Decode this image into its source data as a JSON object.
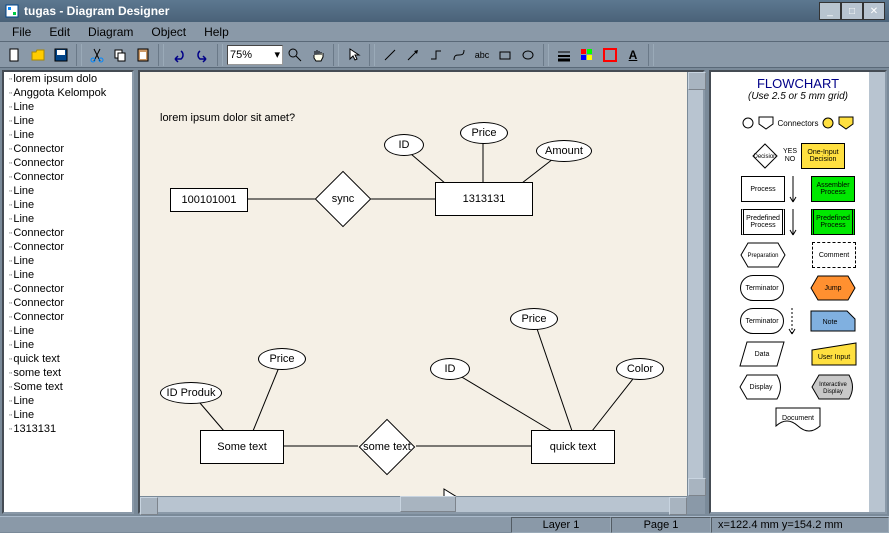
{
  "titlebar": {
    "title": "tugas - Diagram Designer"
  },
  "menu": {
    "file": "File",
    "edit": "Edit",
    "diagram": "Diagram",
    "object": "Object",
    "help": "Help"
  },
  "toolbar": {
    "zoom": "75%"
  },
  "tree": {
    "items": [
      "lorem ipsum dolo",
      "Anggota Kelompok",
      "Line",
      "Line",
      "Line",
      "Connector",
      "Connector",
      "Connector",
      "Line",
      "Line",
      "Line",
      "Connector",
      "Connector",
      "Line",
      "Line",
      "Connector",
      "Connector",
      "Connector",
      "Line",
      "Line",
      "quick text",
      "some text",
      "Some text",
      "Line",
      "Line",
      "1313131"
    ]
  },
  "canvas": {
    "question": "lorem ipsum dolor sit amet?",
    "rect1": "100101001",
    "diamond1": "sync",
    "rect2": "1313131",
    "attr_id": "ID",
    "attr_price": "Price",
    "attr_amount": "Amount",
    "attr_idproduk": "ID Produk",
    "attr_price2": "Price",
    "rect3": "Some text",
    "diamond2": "some text",
    "rect4": "quick text",
    "attr_id2": "ID",
    "attr_price3": "Price",
    "attr_color": "Color"
  },
  "palette": {
    "title": "FLOWCHART",
    "subtitle": "(Use 2.5 or 5 mm grid)",
    "connectors": "Connectors",
    "decision": "Decision",
    "yes": "YES",
    "no": "NO",
    "one_input": "One-Input Decision",
    "process": "Process",
    "assembler": "Assembler Process",
    "predefined": "Predefined Process",
    "predefined2": "Predefined Process",
    "preparation": "Preparation",
    "comment": "Comment",
    "terminator": "Terminator",
    "jump": "Jump",
    "terminator2": "Terminator",
    "note": "Note",
    "data": "Data",
    "user_input": "User Input",
    "display": "Display",
    "interactive": "Interactive Display",
    "document": "Document"
  },
  "status": {
    "layer": "Layer 1",
    "page": "Page 1",
    "coords": "x=122.4 mm  y=154.2 mm"
  }
}
